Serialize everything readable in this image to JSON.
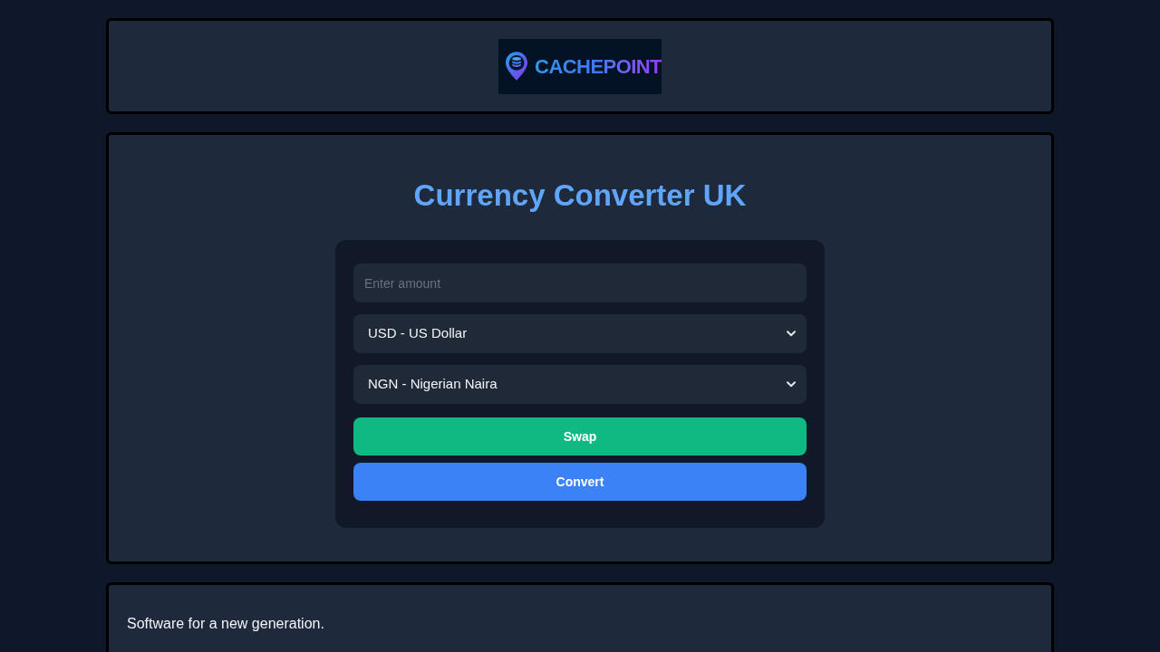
{
  "header": {
    "logo": {
      "text": "CACHEPOINT"
    }
  },
  "converter": {
    "title": "Currency Converter UK",
    "amount": {
      "placeholder": "Enter amount"
    },
    "from_currency": {
      "value": "USD - US Dollar"
    },
    "to_currency": {
      "value": "NGN - Nigerian Naira"
    },
    "buttons": [
      {
        "kind": "swap",
        "label": "Swap"
      },
      {
        "kind": "convert",
        "label": "Convert"
      }
    ]
  },
  "footer": {
    "text": "Software for a new generation."
  }
}
